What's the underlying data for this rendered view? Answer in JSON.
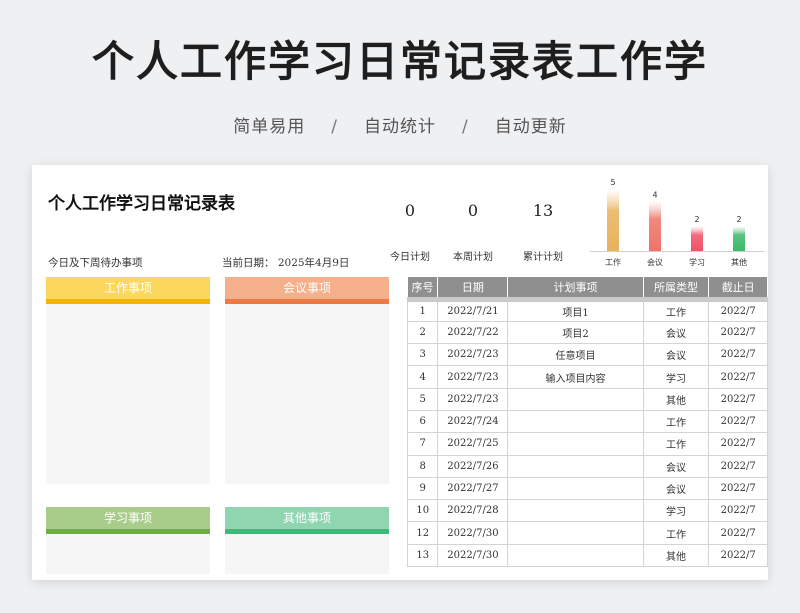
{
  "hero": {
    "title": "个人工作学习日常记录表工作学",
    "subtitles": [
      "简单易用",
      "自动统计",
      "自动更新"
    ],
    "separator": "/"
  },
  "sheet": {
    "title": "个人工作学习日常记录表",
    "todo_label": "今日及下周待办事项",
    "date_label": "当前日期：  2025年4月9日",
    "stats": [
      {
        "value": "0",
        "label": "今日计划"
      },
      {
        "value": "0",
        "label": "本周计划"
      },
      {
        "value": "13",
        "label": "累计计划"
      }
    ],
    "boxes": [
      {
        "label": "工作事项",
        "head_color": "#fbd75d",
        "line_color": "#f5b400"
      },
      {
        "label": "会议事项",
        "head_color": "#f4b08a",
        "line_color": "#ee7a43"
      },
      {
        "label": "学习事项",
        "head_color": "#a8cd8a",
        "line_color": "#6fae44"
      },
      {
        "label": "其他事项",
        "head_color": "#8fd6b0",
        "line_color": "#3fb879"
      }
    ],
    "table": {
      "headers": [
        "序号",
        "日期",
        "计划事项",
        "所属类型",
        "截止日"
      ],
      "rows": [
        [
          "1",
          "2022/7/21",
          "项目1",
          "工作",
          "2022/7"
        ],
        [
          "2",
          "2022/7/22",
          "项目2",
          "会议",
          "2022/7"
        ],
        [
          "3",
          "2022/7/23",
          "任意项目",
          "会议",
          "2022/7"
        ],
        [
          "4",
          "2022/7/23",
          "输入项目内容",
          "学习",
          "2022/7"
        ],
        [
          "5",
          "2022/7/23",
          "",
          "其他",
          "2022/7"
        ],
        [
          "6",
          "2022/7/24",
          "",
          "工作",
          "2022/7"
        ],
        [
          "7",
          "2022/7/25",
          "",
          "工作",
          "2022/7"
        ],
        [
          "8",
          "2022/7/26",
          "",
          "会议",
          "2022/7"
        ],
        [
          "9",
          "2022/7/27",
          "",
          "会议",
          "2022/7"
        ],
        [
          "10",
          "2022/7/28",
          "",
          "学习",
          "2022/7"
        ],
        [
          "12",
          "2022/7/30",
          "",
          "工作",
          "2022/7"
        ],
        [
          "13",
          "2022/7/30",
          "",
          "其他",
          "2022/7"
        ]
      ]
    }
  },
  "chart_data": {
    "type": "bar",
    "categories": [
      "工作",
      "会议",
      "学习",
      "其他"
    ],
    "values": [
      5,
      4,
      2,
      2
    ],
    "colors": [
      "#e8b25c",
      "#ee7469",
      "#ee5267",
      "#3db86c"
    ],
    "ylim": [
      0,
      5
    ],
    "grid": false
  }
}
